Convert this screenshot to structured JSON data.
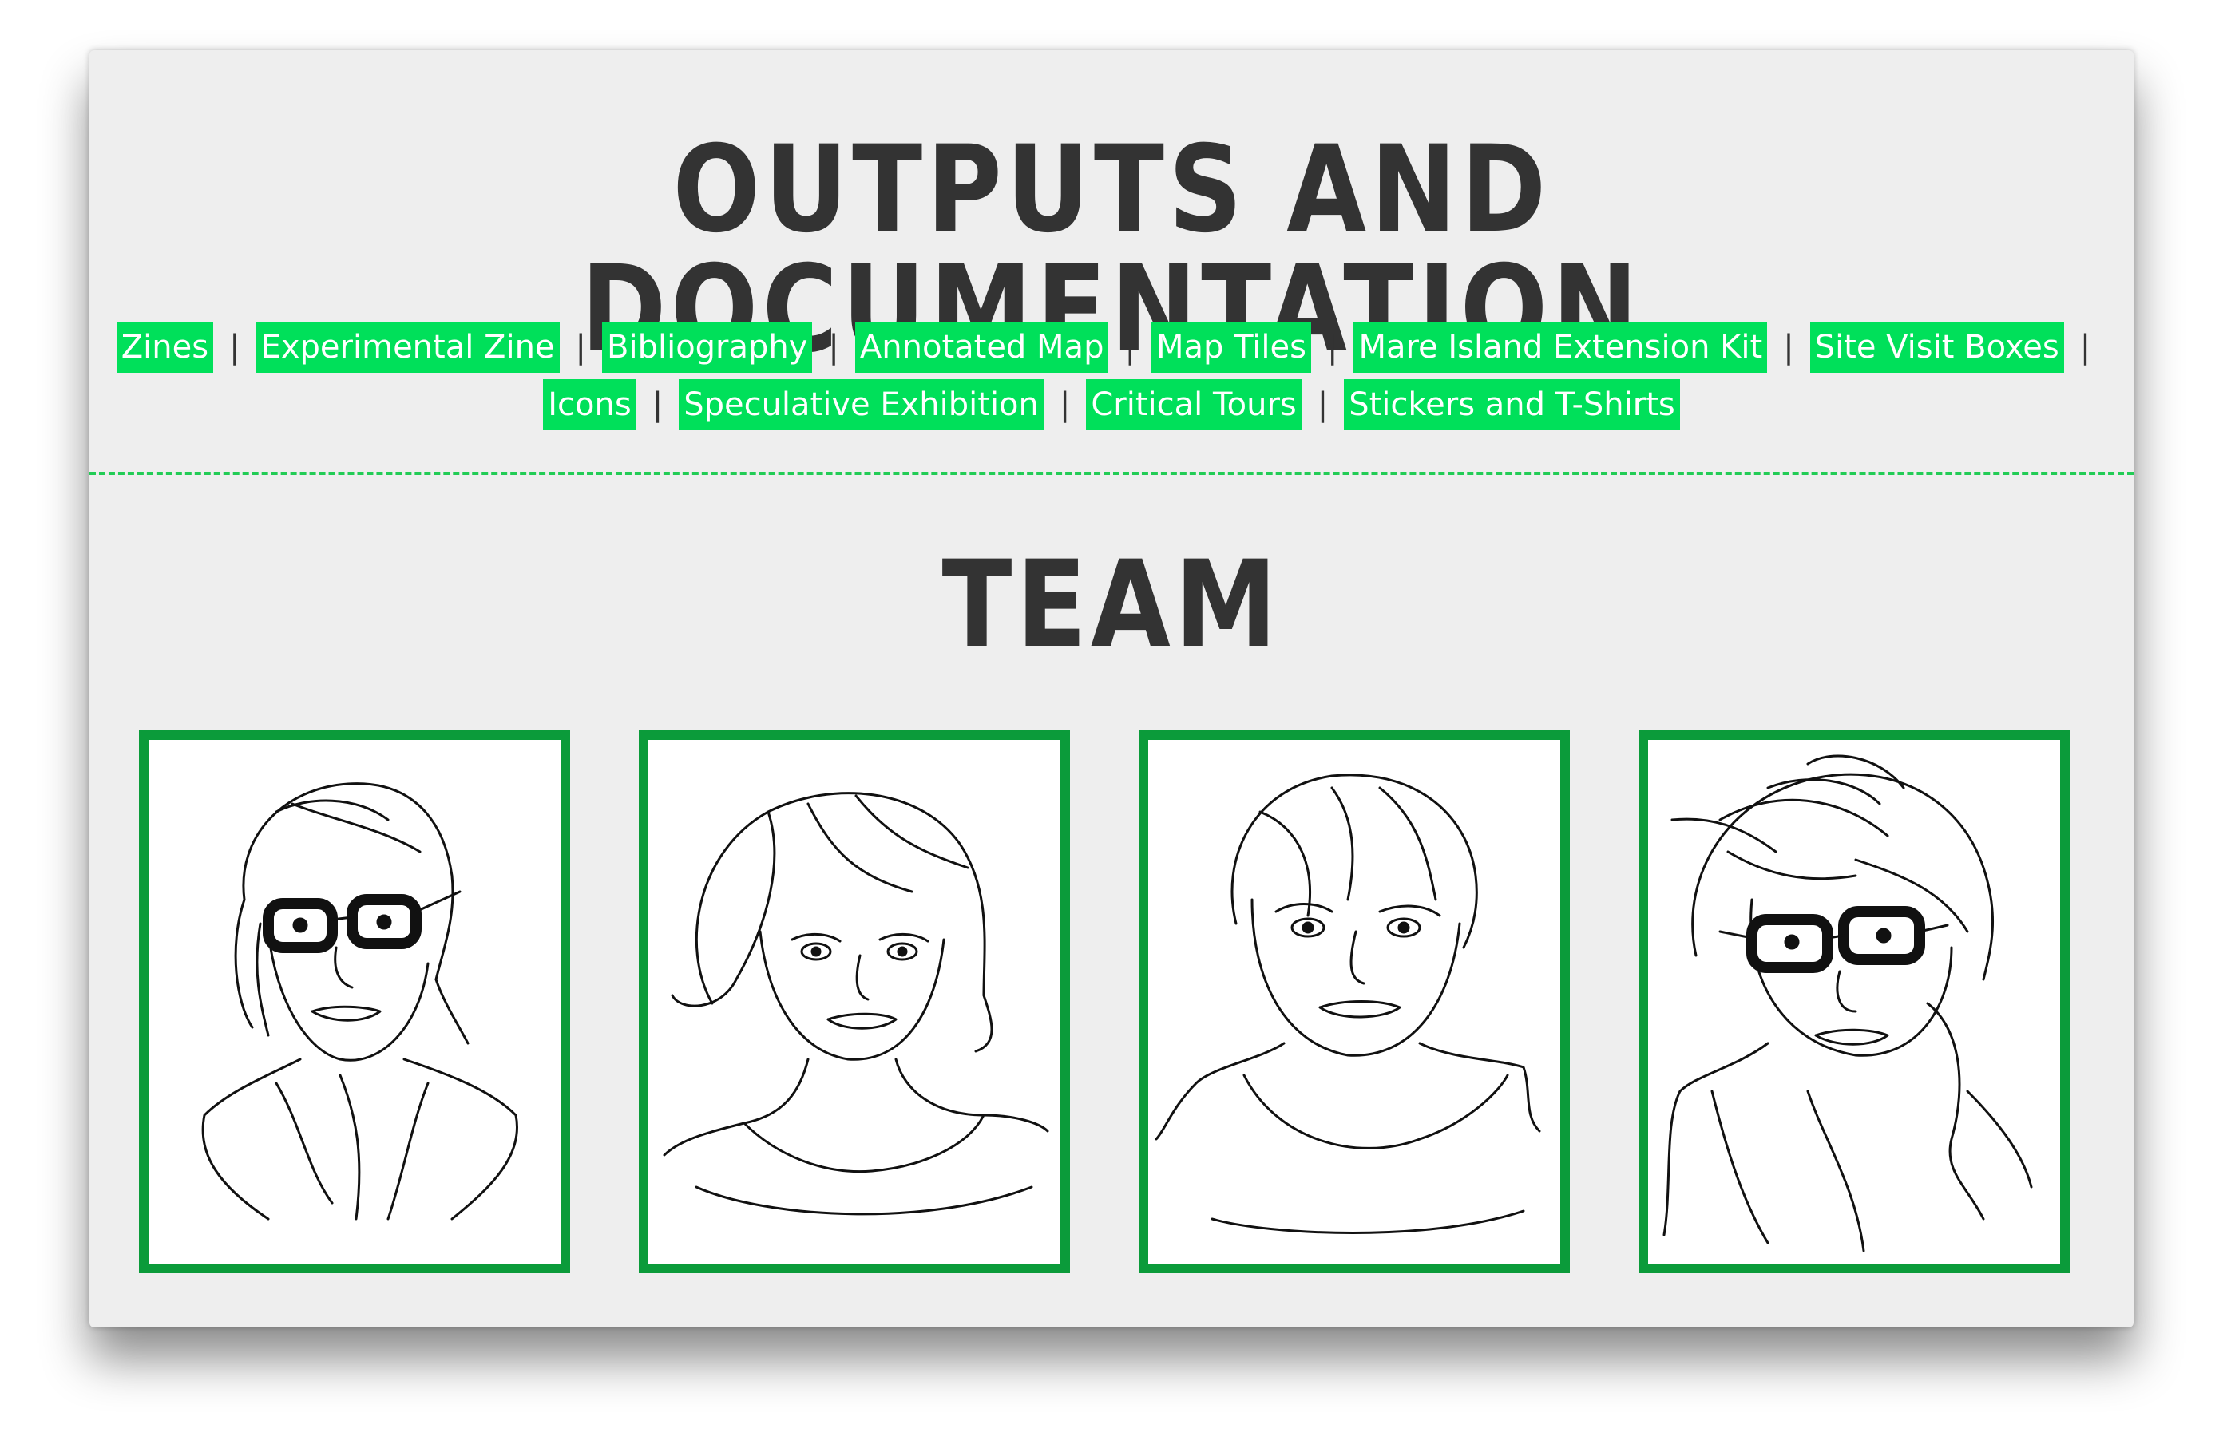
{
  "page": {
    "title": "OUTPUTS AND DOCUMENTATION",
    "team_heading": "TEAM"
  },
  "nav": {
    "row1": [
      "Zines",
      "Experimental Zine",
      "Bibliography",
      "Annotated Map",
      "Map Tiles",
      "Mare Island Extension Kit",
      "Site Visit Boxes"
    ],
    "row2": [
      "Icons",
      "Speculative Exhibition",
      "Critical Tours",
      "Stickers and T-Shirts"
    ],
    "separator": "|"
  },
  "team": {
    "portraits": [
      {
        "glasses": true,
        "hair": "pulled-back"
      },
      {
        "glasses": false,
        "hair": "bob"
      },
      {
        "glasses": false,
        "hair": "short"
      },
      {
        "glasses": true,
        "hair": "messy-bun"
      }
    ]
  },
  "colors": {
    "background": "#eeeeee",
    "link_highlight": "#00e05a",
    "frame_green": "#0b9b3a",
    "text": "#333333"
  }
}
